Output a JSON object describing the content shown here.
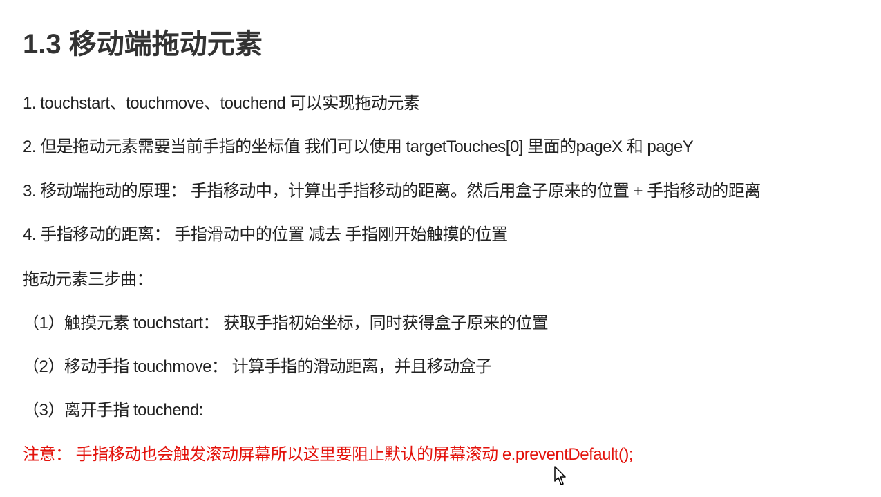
{
  "slide": {
    "title": "1.3 移动端拖动元素",
    "lines": [
      "1. touchstart、touchmove、touchend 可以实现拖动元素",
      "2. 但是拖动元素需要当前手指的坐标值 我们可以使用  targetTouches[0] 里面的pageX 和 pageY",
      "3. 移动端拖动的原理：    手指移动中，计算出手指移动的距离。然后用盒子原来的位置 + 手指移动的距离",
      "4. 手指移动的距离：  手指滑动中的位置 减去  手指刚开始触摸的位置",
      "拖动元素三步曲：",
      "（1）触摸元素 touchstart：  获取手指初始坐标，同时获得盒子原来的位置",
      "（2）移动手指 touchmove：  计算手指的滑动距离，并且移动盒子",
      "（3）离开手指 touchend:"
    ],
    "note": "注意： 手指移动也会触发滚动屏幕所以这里要阻止默认的屏幕滚动 e.preventDefault();"
  },
  "colors": {
    "title": "#333333",
    "text": "#222222",
    "note": "#e3120b"
  },
  "cursor_icon": "mouse-pointer-icon"
}
